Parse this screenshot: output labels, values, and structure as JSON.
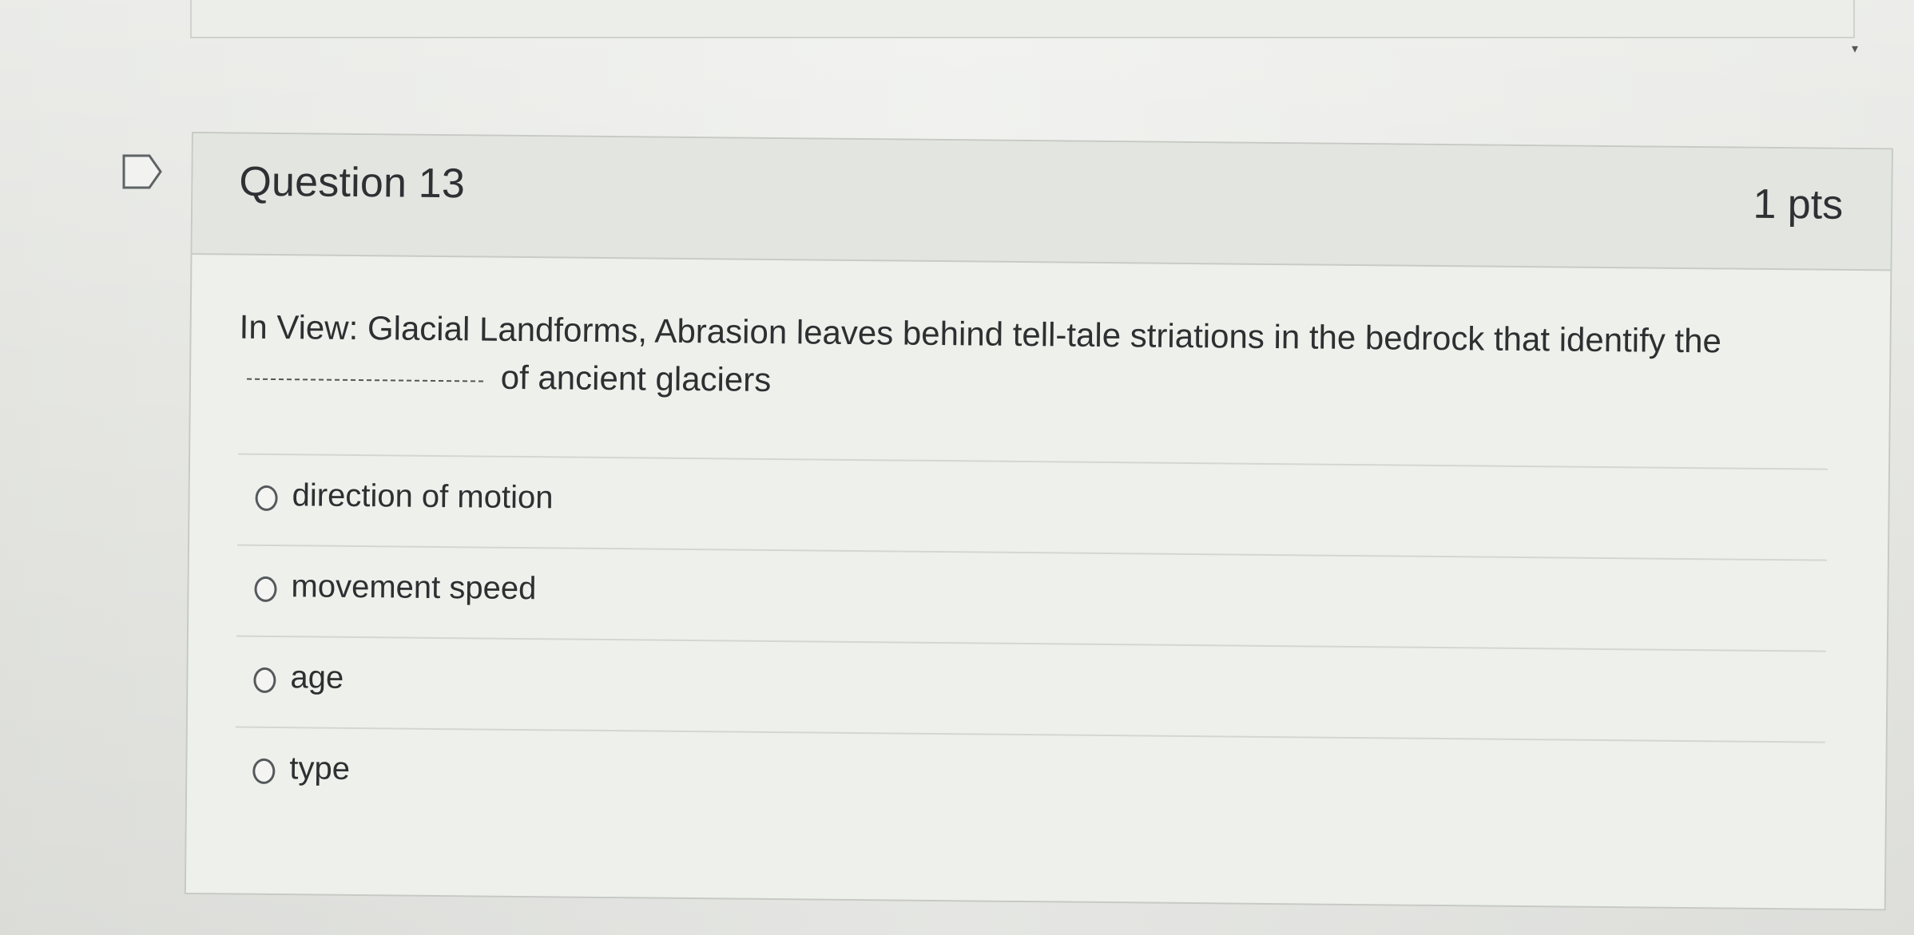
{
  "question": {
    "title": "Question 13",
    "points": "1 pts",
    "text_before": "In View: Glacial Landforms, Abrasion leaves behind tell-tale striations in the bedrock that identify the",
    "blank": "______________",
    "text_after": "of ancient glaciers"
  },
  "answers": [
    {
      "label": "direction of motion",
      "selected": false
    },
    {
      "label": "movement speed",
      "selected": false
    },
    {
      "label": "age",
      "selected": false
    },
    {
      "label": "type",
      "selected": false
    }
  ],
  "icons": {
    "flag": "flag-question-icon",
    "radio": "radio-button-icon"
  },
  "colors": {
    "background": "#e7e8e4",
    "card": "#eef0ec",
    "header": "#e3e5e1",
    "text": "#2d2f31",
    "border": "#c7cac4"
  }
}
